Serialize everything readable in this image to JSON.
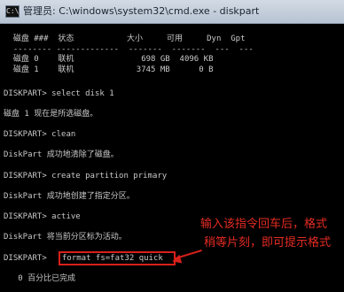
{
  "window": {
    "title": "管理员: C:\\windows\\system32\\cmd.exe - diskpart",
    "icon": "cmd-icon"
  },
  "console": {
    "header": "  磁盘 ###  状态           大小     可用     Dyn  Gpt",
    "separator": "  -------- -------------  -------  -------  ---  ---",
    "disk0": "  磁盘 0    联机              698 GB  4096 KB",
    "disk1": "  磁盘 1    联机             3745 MB      0 B",
    "cmd1": "DISKPART> select disk 1",
    "out1": "磁盘 1 现在是所选磁盘。",
    "cmd2": "DISKPART> clean",
    "out2": "DiskPart 成功地清除了磁盘。",
    "cmd3": "DISKPART> create partition primary",
    "out3": "DiskPart 成功地创建了指定分区。",
    "cmd4": "DISKPART> active",
    "out4": "DiskPart 将当前分区标为活动。",
    "prompt5": "DISKPART>",
    "cmd5": "format fs=fat32 quick",
    "progress": "   0 百分比已完成"
  },
  "annotation": {
    "line1": "输入该指令回车后，格式",
    "line2": "稍等片刻，即可提示格式"
  },
  "colors": {
    "text": "#c9c9c9",
    "annotation": "#e52b23"
  }
}
